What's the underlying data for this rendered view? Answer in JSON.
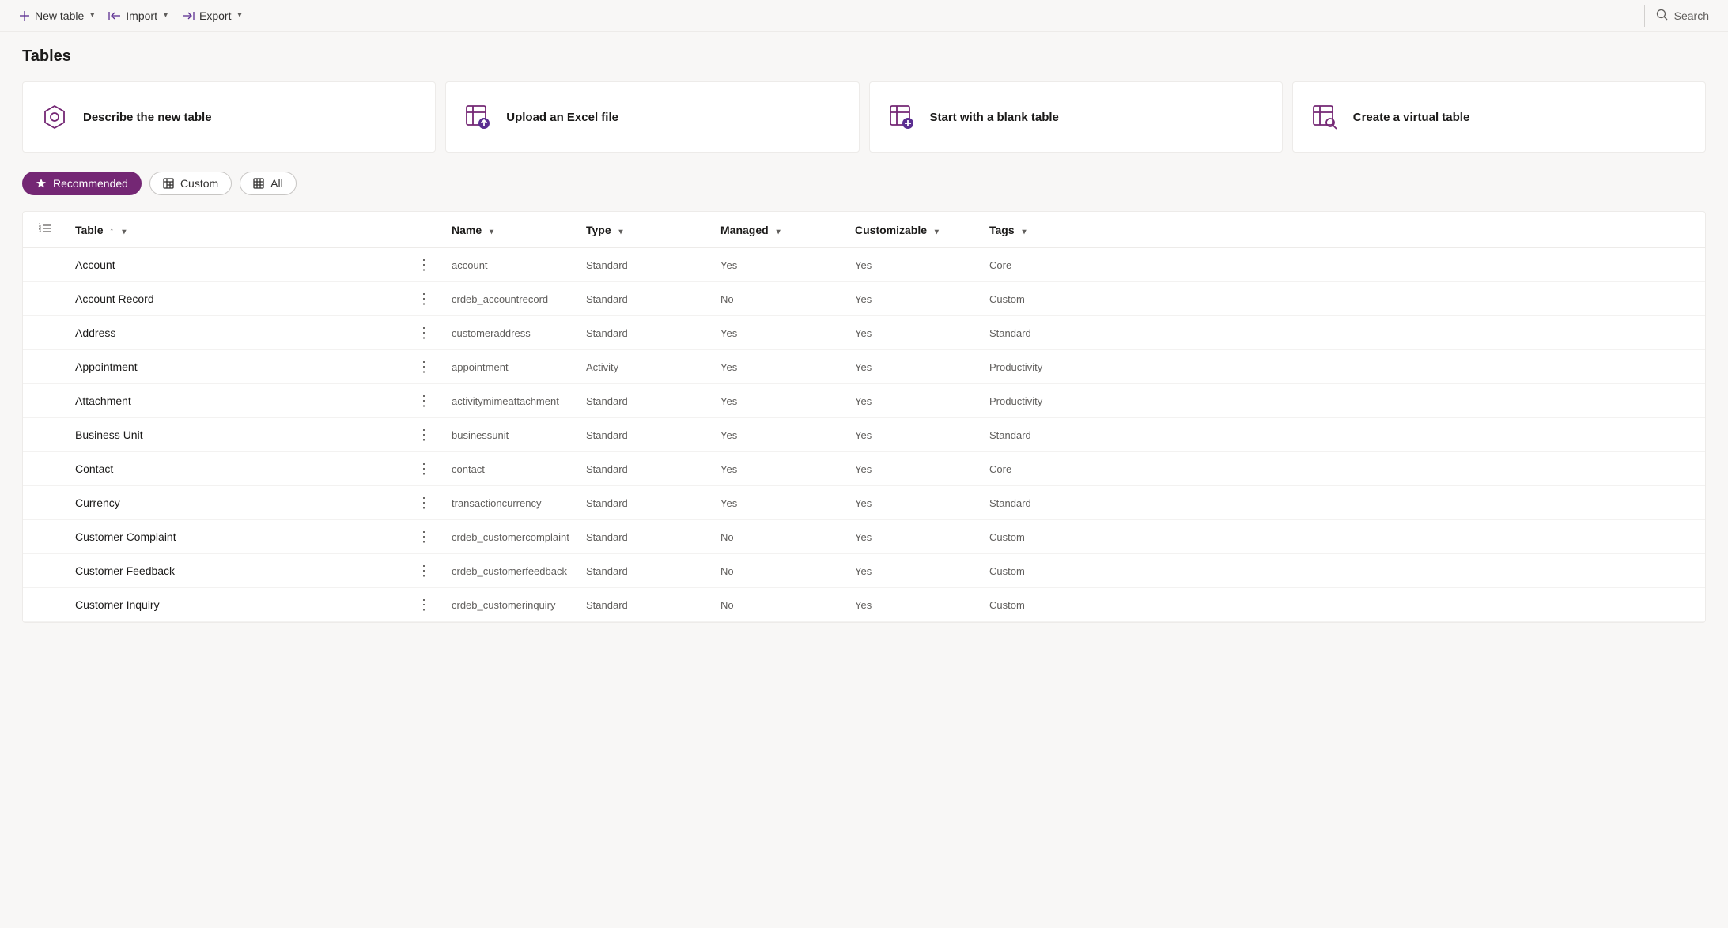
{
  "toolbar": {
    "new_table": "New table",
    "import": "Import",
    "export": "Export",
    "search": "Search"
  },
  "page_title": "Tables",
  "cards": [
    {
      "label": "Describe the new table",
      "icon": "copilot-icon"
    },
    {
      "label": "Upload an Excel file",
      "icon": "table-upload-icon"
    },
    {
      "label": "Start with a blank table",
      "icon": "table-add-icon"
    },
    {
      "label": "Create a virtual table",
      "icon": "table-search-icon"
    }
  ],
  "pills": {
    "recommended": "Recommended",
    "custom": "Custom",
    "all": "All"
  },
  "columns": {
    "table": "Table",
    "name": "Name",
    "type": "Type",
    "managed": "Managed",
    "customizable": "Customizable",
    "tags": "Tags"
  },
  "rows": [
    {
      "display": "Account",
      "name": "account",
      "type": "Standard",
      "managed": "Yes",
      "customizable": "Yes",
      "tags": "Core"
    },
    {
      "display": "Account Record",
      "name": "crdeb_accountrecord",
      "type": "Standard",
      "managed": "No",
      "customizable": "Yes",
      "tags": "Custom"
    },
    {
      "display": "Address",
      "name": "customeraddress",
      "type": "Standard",
      "managed": "Yes",
      "customizable": "Yes",
      "tags": "Standard"
    },
    {
      "display": "Appointment",
      "name": "appointment",
      "type": "Activity",
      "managed": "Yes",
      "customizable": "Yes",
      "tags": "Productivity"
    },
    {
      "display": "Attachment",
      "name": "activitymimeattachment",
      "type": "Standard",
      "managed": "Yes",
      "customizable": "Yes",
      "tags": "Productivity"
    },
    {
      "display": "Business Unit",
      "name": "businessunit",
      "type": "Standard",
      "managed": "Yes",
      "customizable": "Yes",
      "tags": "Standard"
    },
    {
      "display": "Contact",
      "name": "contact",
      "type": "Standard",
      "managed": "Yes",
      "customizable": "Yes",
      "tags": "Core"
    },
    {
      "display": "Currency",
      "name": "transactioncurrency",
      "type": "Standard",
      "managed": "Yes",
      "customizable": "Yes",
      "tags": "Standard"
    },
    {
      "display": "Customer Complaint",
      "name": "crdeb_customercomplaint",
      "type": "Standard",
      "managed": "No",
      "customizable": "Yes",
      "tags": "Custom"
    },
    {
      "display": "Customer Feedback",
      "name": "crdeb_customerfeedback",
      "type": "Standard",
      "managed": "No",
      "customizable": "Yes",
      "tags": "Custom"
    },
    {
      "display": "Customer Inquiry",
      "name": "crdeb_customerinquiry",
      "type": "Standard",
      "managed": "No",
      "customizable": "Yes",
      "tags": "Custom"
    }
  ]
}
